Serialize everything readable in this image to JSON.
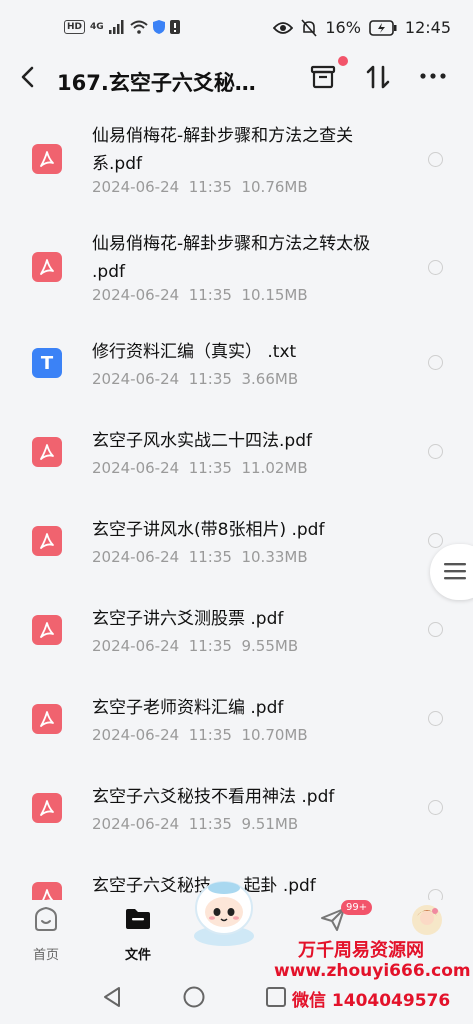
{
  "status": {
    "left_badges": [
      "HD",
      "4G"
    ],
    "battery": "16%",
    "time": "12:45"
  },
  "header": {
    "title": "167.玄空子六爻秘…"
  },
  "files": [
    {
      "type": "pdf",
      "name": "仙易俏梅花-解卦步骤和方法之查关系.pdf",
      "meta": "2024-06-24  11:35  10.76MB"
    },
    {
      "type": "pdf",
      "name": "仙易俏梅花-解卦步骤和方法之转太极 .pdf",
      "meta": "2024-06-24  11:35  10.15MB"
    },
    {
      "type": "txt",
      "icon_letter": "T",
      "name": "修行资料汇编（真实） .txt",
      "meta": "2024-06-24  11:35  3.66MB"
    },
    {
      "type": "pdf",
      "name": "玄空子风水实战二十四法.pdf",
      "meta": "2024-06-24  11:35  11.02MB"
    },
    {
      "type": "pdf",
      "name": "玄空子讲风水(带8张相片) .pdf",
      "meta": "2024-06-24  11:35  10.33MB"
    },
    {
      "type": "pdf",
      "name": "玄空子讲六爻测股票  .pdf",
      "meta": "2024-06-24  11:35  9.55MB"
    },
    {
      "type": "pdf",
      "name": "玄空子老师资料汇编 .pdf",
      "meta": "2024-06-24  11:35  10.70MB"
    },
    {
      "type": "pdf",
      "name": "玄空子六爻秘技不看用神法  .pdf",
      "meta": "2024-06-24  11:35  9.51MB"
    },
    {
      "type": "pdf",
      "name": "玄空子六爻秘技      起卦 .pdf",
      "meta": ""
    }
  ],
  "bottom_nav": {
    "home": "首页",
    "files": "文件",
    "share_badge": "99+"
  },
  "watermark": {
    "line1": "万千周易资源网",
    "line2": "www.zhouyi666.com",
    "line3": "微信 1404049576"
  },
  "colors": {
    "pdf_icon": "#f0636f",
    "txt_icon": "#3b82f6",
    "badge": "#f2546a",
    "watermark": "#e3122a"
  }
}
